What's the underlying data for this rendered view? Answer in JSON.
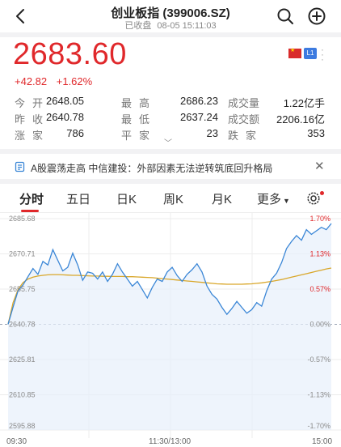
{
  "header": {
    "title": "创业板指 (399006.SZ)",
    "status": "已收盘",
    "datetime": "08-05 15:11:03"
  },
  "quote": {
    "price": "2683.60",
    "change": "+42.82",
    "change_pct": "+1.62%",
    "exchange_badge": "L1"
  },
  "stats": {
    "row1": [
      {
        "label": "今开",
        "value": "2648.05"
      },
      {
        "label": "最高",
        "value": "2686.23"
      },
      {
        "label": "成交量",
        "value": "1.22亿手"
      }
    ],
    "row2": [
      {
        "label": "昨收",
        "value": "2640.78"
      },
      {
        "label": "最低",
        "value": "2637.24"
      },
      {
        "label": "成交额",
        "value": "2206.16亿"
      }
    ],
    "row3": [
      {
        "label": "涨家",
        "value": "786"
      },
      {
        "label": "平家",
        "value": "23"
      },
      {
        "label": "跌家",
        "value": "353"
      }
    ]
  },
  "news": {
    "text": "A股震荡走高 中信建投：外部因素无法逆转筑底回升格局"
  },
  "tabs": [
    "分时",
    "五日",
    "日K",
    "周K",
    "月K",
    "更多"
  ],
  "colors": {
    "up": "#e0282b",
    "price_line": "#3a86d6",
    "avg_line": "#d9a72a",
    "accent": "#e0282b"
  },
  "chart_data": {
    "type": "line",
    "title": "",
    "xlabel": "",
    "ylabel": "",
    "prev_close": 2640.78,
    "ylim": [
      2595.88,
      2685.68
    ],
    "y_ticks_left": [
      "2685.68",
      "2670.71",
      "2655.75",
      "2640.78",
      "2625.81",
      "2610.85",
      "2595.88"
    ],
    "y_ticks_right": [
      "1.70%",
      "1.13%",
      "0.57%",
      "0.00%",
      "-0.57%",
      "-1.13%",
      "-1.70%"
    ],
    "x_ticks": [
      "09:30",
      "11:30/13:00",
      "15:00"
    ],
    "series": [
      {
        "values": [
          2640.8,
          2648.1,
          2655.0,
          2657.5,
          2661.0,
          2664.5,
          2662.0,
          2667.5,
          2666.0,
          2672.5,
          2668.0,
          2663.5,
          2665.0,
          2671.0,
          2666.0,
          2659.5,
          2663.0,
          2662.5,
          2660.0,
          2663.0,
          2659.0,
          2662.0,
          2666.5,
          2663.0,
          2660.0,
          2657.0,
          2659.0,
          2655.5,
          2652.0,
          2656.5,
          2660.0,
          2659.0,
          2663.0,
          2665.0,
          2661.5,
          2659.0,
          2662.0,
          2664.0,
          2666.5,
          2663.0,
          2657.0,
          2653.5,
          2651.5,
          2648.0,
          2645.0,
          2647.5,
          2650.5,
          2648.0,
          2645.5,
          2647.0,
          2650.0,
          2648.5,
          2655.0,
          2660.0,
          2662.5,
          2667.0,
          2673.0,
          2676.0,
          2678.5,
          2676.5,
          2681.0,
          2679.0,
          2680.5,
          2682.0,
          2681.0,
          2683.6
        ]
      },
      {
        "values": [
          2640.8,
          2650.0,
          2655.5,
          2658.5,
          2660.0,
          2660.8,
          2661.3,
          2661.6,
          2661.8,
          2661.9,
          2661.9,
          2661.8,
          2661.7,
          2661.6,
          2661.6,
          2661.5,
          2661.4,
          2661.3,
          2661.3,
          2661.2,
          2661.2,
          2661.1,
          2661.1,
          2661.1,
          2661.0,
          2661.0,
          2660.9,
          2660.8,
          2660.7,
          2660.6,
          2660.4,
          2660.2,
          2660.0,
          2659.8,
          2659.6,
          2659.4,
          2659.2,
          2659.0,
          2658.8,
          2658.6,
          2658.4,
          2658.2,
          2658.0,
          2657.9,
          2657.8,
          2657.8,
          2657.8,
          2657.8,
          2657.9,
          2658.0,
          2658.2,
          2658.4,
          2658.7,
          2659.0,
          2659.4,
          2659.8,
          2660.3,
          2660.8,
          2661.3,
          2661.8,
          2662.3,
          2662.8,
          2663.3,
          2663.8,
          2664.3,
          2664.7
        ]
      }
    ]
  }
}
